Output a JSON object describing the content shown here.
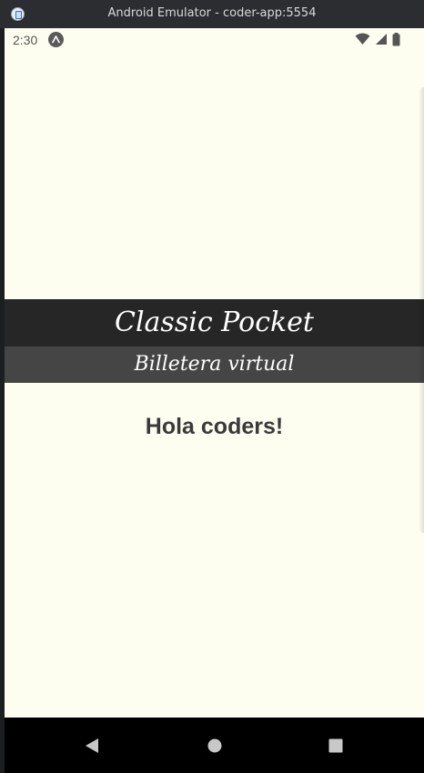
{
  "window": {
    "title": "Android Emulator - coder-app:5554",
    "icon": "emulator-app-icon"
  },
  "statusbar": {
    "time": "2:30",
    "app_icon": "expo-icon",
    "icons": [
      "wifi-icon",
      "cell-signal-icon",
      "battery-icon"
    ]
  },
  "app": {
    "title": "Classic Pocket",
    "subtitle": "Billetera virtual",
    "greeting": "Hola coders!",
    "colors": {
      "background": "#fefef0",
      "header": "#262626",
      "subheader": "#454545",
      "greeting_text": "#3a3a3a"
    }
  },
  "navbar": {
    "buttons": [
      "back-icon",
      "home-icon",
      "recents-icon"
    ]
  }
}
